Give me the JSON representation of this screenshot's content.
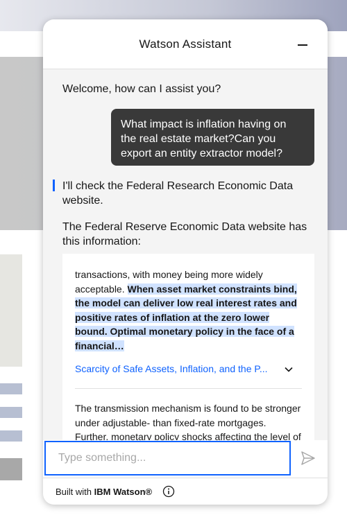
{
  "header": {
    "title": "Watson Assistant"
  },
  "messages": {
    "welcome": "Welcome, how can I assist you?",
    "user_message": "What impact is inflation having on the real estate market?Can you export an entity extractor model?",
    "status": "I'll check the Federal Research Economic Data website.",
    "intro": "The Federal Reserve Economic Data website has this information:"
  },
  "result1": {
    "text_before": "transactions, with money being more widely acceptable. ",
    "highlight": "When asset market constraints bind, the model can deliver low real interest rates and positive rates of inflation at the zero lower bound. Optimal monetary policy in the face of a financial…",
    "link": "Scarcity of Safe Assets, Inflation, and the P..."
  },
  "result2": {
    "text": "The transmission mechanism is found to be stronger under adjustable- than fixed-rate mortgages. Further, monetary policy shocks affecting the level of the nominal yield curve have larger real effects than"
  },
  "input": {
    "placeholder": "Type something..."
  },
  "footer": {
    "built_with": "Built with ",
    "brand": "IBM Watson®"
  },
  "help_label": "?",
  "colors": {
    "accent": "#0f62fe",
    "user_bubble": "#393939",
    "highlight": "#d0e2ff"
  },
  "icons": [
    "minimize-icon",
    "chevron-down-icon",
    "help-icon",
    "send-icon",
    "info-icon"
  ]
}
